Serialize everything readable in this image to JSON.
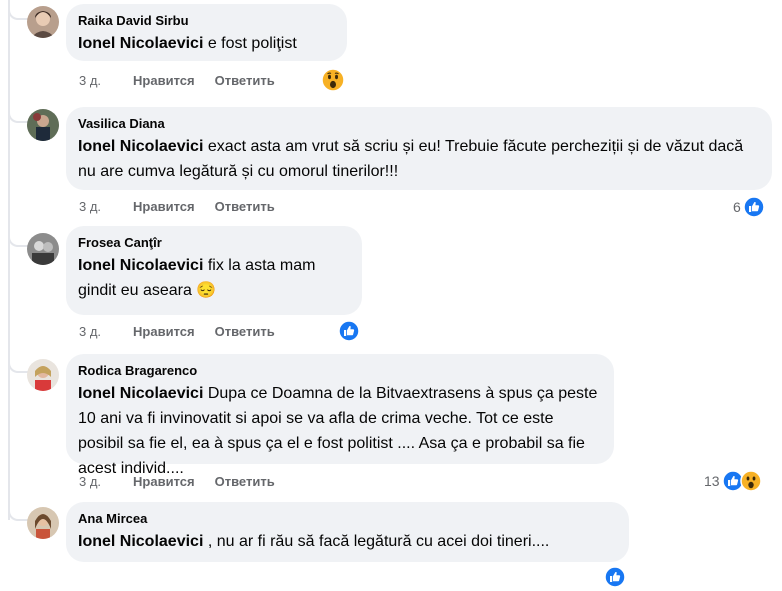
{
  "comments": [
    {
      "author": "Raika David Sirbu",
      "mention": "Ionel Nicolaevici",
      "text": " e fost poliţist",
      "time": "3 д.",
      "like": "Нравится",
      "reply": "Ответить",
      "reactions": [
        "wow"
      ],
      "reaction_count": ""
    },
    {
      "author": "Vasilica Diana",
      "mention": "Ionel Nicolaevici",
      "text": " exact asta am vrut să scriu și eu! Trebuie făcute percheziții și de văzut dacă nu are cumva legătură și cu omorul tinerilor!!!",
      "time": "3 д.",
      "like": "Нравится",
      "reply": "Ответить",
      "reactions": [
        "like"
      ],
      "reaction_count": "6"
    },
    {
      "author": "Frosea Canţîr",
      "mention": "Ionel Nicolaevici",
      "text": " fix la asta mam gindit eu aseara 😔",
      "time": "3 д.",
      "like": "Нравится",
      "reply": "Ответить",
      "reactions": [
        "like"
      ],
      "reaction_count": ""
    },
    {
      "author": "Rodica Bragarenco",
      "mention": "Ionel Nicolaevici",
      "text": " Dupa ce Doamna de la Bitvaextrasens à spus ça peste 10 ani va fi invinovatit si apoi se va afla de crima veche. Tot ce este posibil sa fie el, ea à spus ça el e fost politist .... Asa ça e probabil sa fie acest individ....",
      "time": "3 д.",
      "like": "Нравится",
      "reply": "Ответить",
      "reactions": [
        "like",
        "wow"
      ],
      "reaction_count": "13"
    },
    {
      "author": "Ana Mircea",
      "mention": "Ionel Nicolaevici",
      "text": " , nu ar fi rău să facă legătură cu acei doi tineri....",
      "time": "",
      "like": "",
      "reply": "",
      "reactions": [
        "like"
      ],
      "reaction_count": ""
    }
  ],
  "colors": {
    "bubble": "#f0f2f5",
    "meta": "#65676b",
    "like_blue": "#1877f2",
    "wow_yellow": "#f7b125"
  }
}
